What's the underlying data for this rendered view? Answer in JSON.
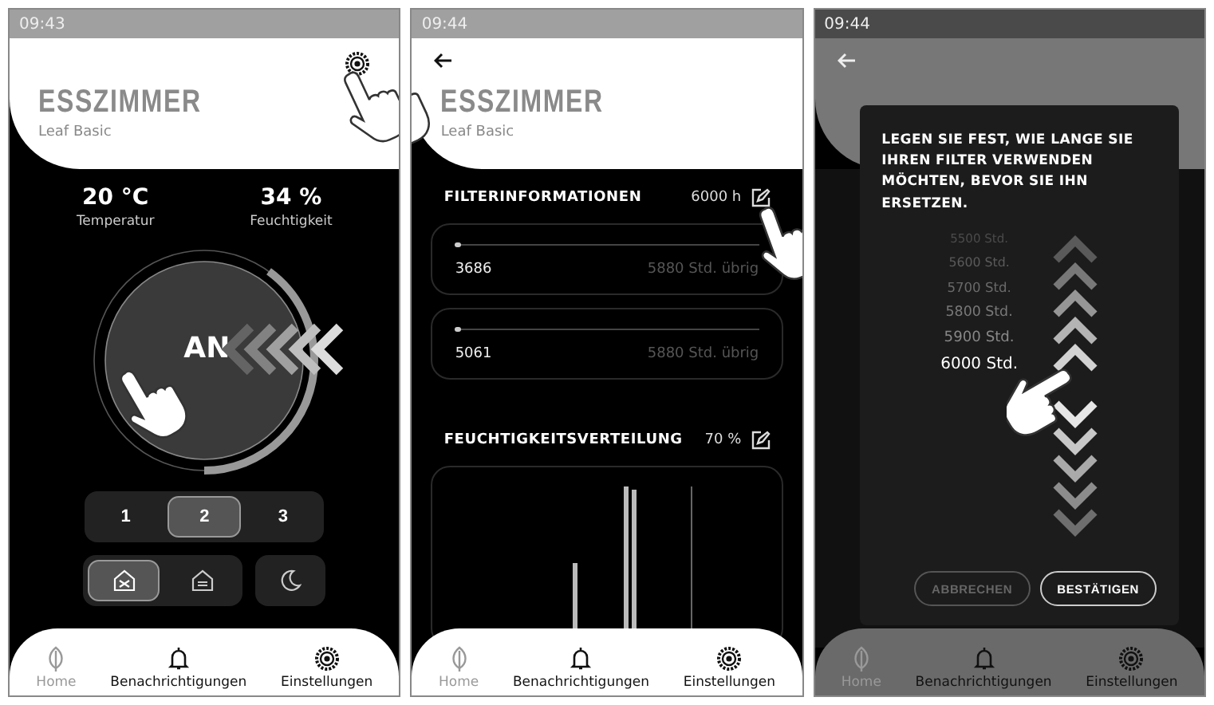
{
  "screens": [
    {
      "kind": "home",
      "time": "09:43",
      "title": "ESSZIMMER",
      "subtitle": "Leaf Basic",
      "stats": [
        {
          "value": "20 °C",
          "label": "Temperatur"
        },
        {
          "value": "34 %",
          "label": "Feuchtigkeit"
        }
      ],
      "dial": {
        "label": "AN",
        "level": 0.4
      },
      "speeds": [
        {
          "label": "1",
          "selected": false
        },
        {
          "label": "2",
          "selected": true
        },
        {
          "label": "3",
          "selected": false
        }
      ],
      "modes": [
        {
          "kind": "ventilation",
          "selected": true
        },
        {
          "kind": "extract",
          "selected": false
        }
      ],
      "night": {
        "selected": false
      },
      "nav": [
        {
          "label": "Home",
          "selected": true
        },
        {
          "label": "Benachrichtigungen",
          "selected": false
        },
        {
          "label": "Einstellungen",
          "selected": false
        }
      ]
    },
    {
      "kind": "filter",
      "time": "09:44",
      "title": "ESSZIMMER",
      "subtitle": "Leaf Basic",
      "filter": {
        "heading": "FILTERINFORMATIONEN",
        "value": "6000 h",
        "items": [
          {
            "value": "3686",
            "remaining": "5880 Std. übrig",
            "level": 0.02
          },
          {
            "value": "5061",
            "remaining": "5880 Std. übrig",
            "level": 0.02
          }
        ]
      },
      "humidity": {
        "heading": "FEUCHTIGKEITSVERTEILUNG",
        "value": "70 %"
      },
      "nav": [
        {
          "label": "Home",
          "selected": true
        },
        {
          "label": "Benachrichtigungen",
          "selected": false
        },
        {
          "label": "Einstellungen",
          "selected": false
        }
      ]
    },
    {
      "kind": "picker",
      "time": "09:44",
      "prompt": "LEGEN SIE FEST, WIE LANGE SIE IHREN FILTER VERWENDEN MÖCHTEN, BEVOR SIE IHN ERSETZEN.",
      "options": [
        {
          "label": "5500 Std.",
          "selected": false
        },
        {
          "label": "5600 Std.",
          "selected": false
        },
        {
          "label": "5700 Std.",
          "selected": false
        },
        {
          "label": "5800 Std.",
          "selected": false
        },
        {
          "label": "5900 Std.",
          "selected": false
        },
        {
          "label": "6000 Std.",
          "selected": true
        }
      ],
      "buttons": [
        {
          "label": "ABBRECHEN",
          "disabled": true
        },
        {
          "label": "BESTÄTIGEN",
          "disabled": false
        }
      ],
      "nav": [
        {
          "label": "Home",
          "selected": true
        },
        {
          "label": "Benachrichtigungen",
          "selected": false
        },
        {
          "label": "Einstellungen",
          "selected": false
        }
      ]
    }
  ]
}
